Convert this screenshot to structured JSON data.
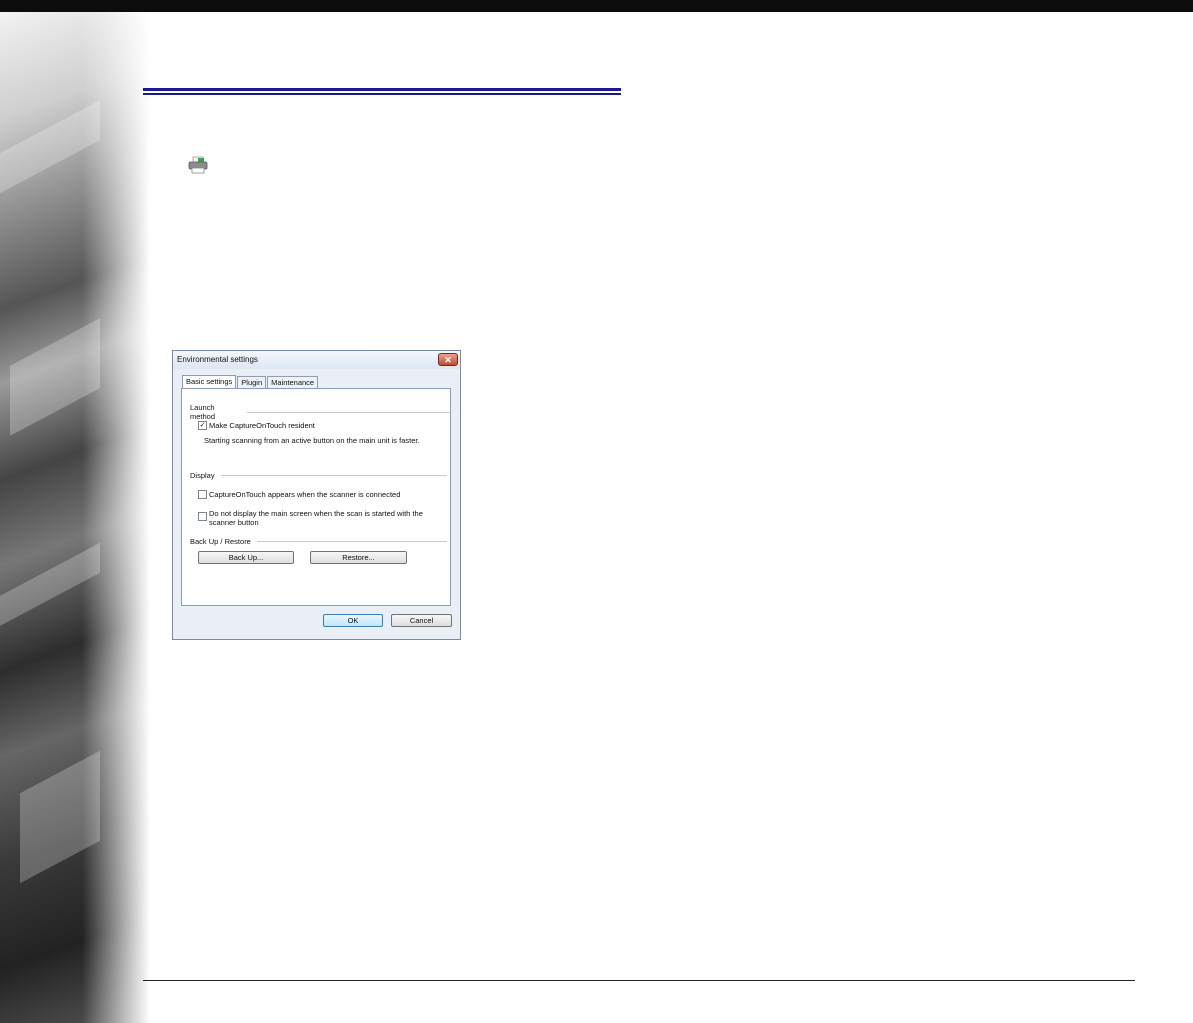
{
  "dialog": {
    "title": "Environmental settings",
    "close_glyph": "✕",
    "tabs": [
      "Basic settings",
      "Plugin",
      "Maintenance"
    ],
    "launch_method": {
      "heading": "Launch method",
      "resident_checkbox": {
        "label": "Make CaptureOnTouch resident",
        "checked": true
      },
      "note": "Starting scanning from an active button on the main unit is faster."
    },
    "display": {
      "heading": "Display",
      "appear_checkbox": {
        "label": "CaptureOnTouch appears when the scanner is connected",
        "checked": false
      },
      "no_main_checkbox": {
        "label": "Do not display the main screen when the scan is started with the scanner button",
        "checked": false
      }
    },
    "backup_restore": {
      "heading": "Back Up / Restore",
      "backup_label": "Back Up...",
      "restore_label": "Restore..."
    },
    "ok_label": "OK",
    "cancel_label": "Cancel"
  },
  "icons": {
    "printer": "printer-icon",
    "close": "close-icon"
  },
  "colors": {
    "title_rule": "#1a1a8c",
    "top_bar": "#0c0c0c"
  }
}
